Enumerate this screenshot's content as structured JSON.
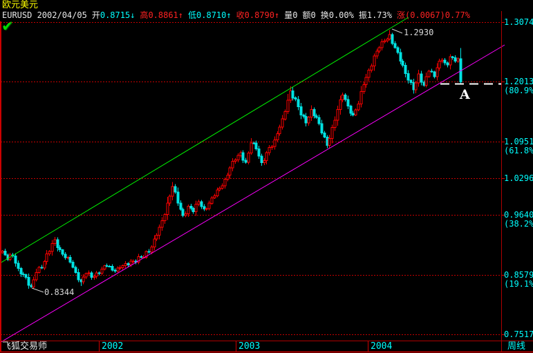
{
  "header": {
    "title": "欧元美元",
    "check_glyph": "✔",
    "fields": [
      {
        "label": "EURUSD 2002/04/05",
        "lc": "#e8e8e8",
        "value": "",
        "vc": "#e8e8e8"
      },
      {
        "label": "开",
        "lc": "#e8e8e8",
        "value": "0.8715↓",
        "vc": "#00ffff"
      },
      {
        "label": "高",
        "lc": "#ff2222",
        "value": "0.8861↑",
        "vc": "#ff2222"
      },
      {
        "label": "低",
        "lc": "#00ffff",
        "value": "0.8710↑",
        "vc": "#00ffff"
      },
      {
        "label": "收",
        "lc": "#ff2222",
        "value": "0.8790↑",
        "vc": "#ff2222"
      },
      {
        "label": "量",
        "lc": "#e8e8e8",
        "value": "0",
        "vc": "#e8e8e8"
      },
      {
        "label": "额",
        "lc": "#e8e8e8",
        "value": "0",
        "vc": "#e8e8e8"
      },
      {
        "label": "换",
        "lc": "#e8e8e8",
        "value": "0.00%",
        "vc": "#e8e8e8"
      },
      {
        "label": "振",
        "lc": "#e8e8e8",
        "value": "1.73%",
        "vc": "#e8e8e8"
      },
      {
        "label": "涨",
        "lc": "#ff2222",
        "value": "(0.0067)0.77%",
        "vc": "#ff2222"
      }
    ]
  },
  "footer": {
    "app_name": "飞狐交易师",
    "timeframe": "周线",
    "years": [
      {
        "label": "2002",
        "x": 143
      },
      {
        "label": "2003",
        "x": 341
      },
      {
        "label": "2004",
        "x": 532
      }
    ]
  },
  "chart_data": {
    "type": "candlestick",
    "symbol": "EURUSD",
    "instrument_name": "欧元美元",
    "timeframe": "周线",
    "selected_bar": {
      "date": "2002/04/05",
      "open": "0.8715",
      "high": "0.8861",
      "low": "0.8710",
      "close": "0.8790",
      "volume": "0",
      "amount": "0",
      "turnover": "0.00%",
      "amplitude": "1.73%",
      "change": "(0.0067)0.77%"
    },
    "y_axis": {
      "levels": [
        {
          "price": "1.3074",
          "pct": ""
        },
        {
          "price": "1.2013",
          "pct": "(80.9%)"
        },
        {
          "price": "1.0951",
          "pct": "(61.8%)"
        },
        {
          "price": "1.0296",
          "pct": ""
        },
        {
          "price": "0.9640",
          "pct": "(38.2%)"
        },
        {
          "price": "0.8579",
          "pct": "(19.1%)"
        },
        {
          "price": "0.7517",
          "pct": ""
        }
      ]
    },
    "annotations": {
      "high_label": "1.2930",
      "low_label": "0.8344",
      "point_label": "A",
      "support_dash_price": 1.1977
    },
    "trend_channel": {
      "upper": {
        "x1": 0,
        "y1": 381,
        "x2": 591,
        "y2": 25
      },
      "lower": {
        "x1": 0,
        "y1": 496,
        "x2": 730,
        "y2": 65
      }
    },
    "series": {
      "weeks": 176,
      "anchors": [
        [
          0,
          0.9
        ],
        [
          2,
          0.885
        ],
        [
          4,
          0.8915
        ],
        [
          6,
          0.869
        ],
        [
          8,
          0.858
        ],
        [
          11,
          0.836
        ],
        [
          13,
          0.862
        ],
        [
          15,
          0.87
        ],
        [
          17,
          0.895
        ],
        [
          20,
          0.92
        ],
        [
          22,
          0.902
        ],
        [
          24,
          0.888
        ],
        [
          26,
          0.88
        ],
        [
          28,
          0.862
        ],
        [
          30,
          0.845
        ],
        [
          32,
          0.86
        ],
        [
          34,
          0.853
        ],
        [
          36,
          0.861
        ],
        [
          38,
          0.868
        ],
        [
          40,
          0.873
        ],
        [
          42,
          0.866
        ],
        [
          44,
          0.87
        ],
        [
          47,
          0.878
        ],
        [
          50,
          0.882
        ],
        [
          53,
          0.889
        ],
        [
          56,
          0.898
        ],
        [
          59,
          0.928
        ],
        [
          62,
          0.965
        ],
        [
          65,
          1.015
        ],
        [
          67,
          0.985
        ],
        [
          69,
          0.963
        ],
        [
          71,
          0.98
        ],
        [
          73,
          0.97
        ],
        [
          75,
          0.988
        ],
        [
          77,
          0.975
        ],
        [
          79,
          0.985
        ],
        [
          81,
          0.998
        ],
        [
          83,
          1.012
        ],
        [
          85,
          1.028
        ],
        [
          87,
          1.048
        ],
        [
          89,
          1.062
        ],
        [
          91,
          1.075
        ],
        [
          93,
          1.058
        ],
        [
          95,
          1.092
        ],
        [
          97,
          1.082
        ],
        [
          99,
          1.057
        ],
        [
          101,
          1.075
        ],
        [
          104,
          1.098
        ],
        [
          107,
          1.135
        ],
        [
          110,
          1.185
        ],
        [
          112,
          1.17
        ],
        [
          114,
          1.142
        ],
        [
          116,
          1.128
        ],
        [
          118,
          1.152
        ],
        [
          120,
          1.138
        ],
        [
          122,
          1.11
        ],
        [
          124,
          1.088
        ],
        [
          126,
          1.12
        ],
        [
          128,
          1.152
        ],
        [
          130,
          1.178
        ],
        [
          132,
          1.158
        ],
        [
          134,
          1.142
        ],
        [
          136,
          1.162
        ],
        [
          138,
          1.196
        ],
        [
          140,
          1.222
        ],
        [
          142,
          1.247
        ],
        [
          144,
          1.262
        ],
        [
          146,
          1.274
        ],
        [
          148,
          1.285
        ],
        [
          150,
          1.262
        ],
        [
          152,
          1.238
        ],
        [
          154,
          1.216
        ],
        [
          156,
          1.2
        ],
        [
          157,
          1.187
        ],
        [
          159,
          1.215
        ],
        [
          161,
          1.195
        ],
        [
          163,
          1.22
        ],
        [
          165,
          1.21
        ],
        [
          166,
          1.226
        ],
        [
          168,
          1.24
        ],
        [
          170,
          1.231
        ],
        [
          171,
          1.246
        ],
        [
          173,
          1.238
        ],
        [
          174,
          1.242
        ],
        [
          175,
          1.201
        ]
      ],
      "wick_overrides": {
        "11": {
          "low": 0.8344
        },
        "20": {
          "high": 0.925
        },
        "30": {
          "low": 0.838
        },
        "65": {
          "high": 1.023
        },
        "110": {
          "high": 1.193
        },
        "124": {
          "low": 1.083
        },
        "148": {
          "high": 1.293
        },
        "157": {
          "low": 1.18
        },
        "171": {
          "high": 1.25
        },
        "175": {
          "low": 1.197
        }
      }
    },
    "colors": {
      "up": "#ff0000",
      "down": "#00e2e2",
      "grid": "#c80000",
      "border": "#b00000",
      "upper_line": "#00ee00",
      "lower_line": "#ff00ff",
      "dash": "#ffffff",
      "axis_text": "#00ffff",
      "pointer": "#cfcfcf"
    }
  }
}
